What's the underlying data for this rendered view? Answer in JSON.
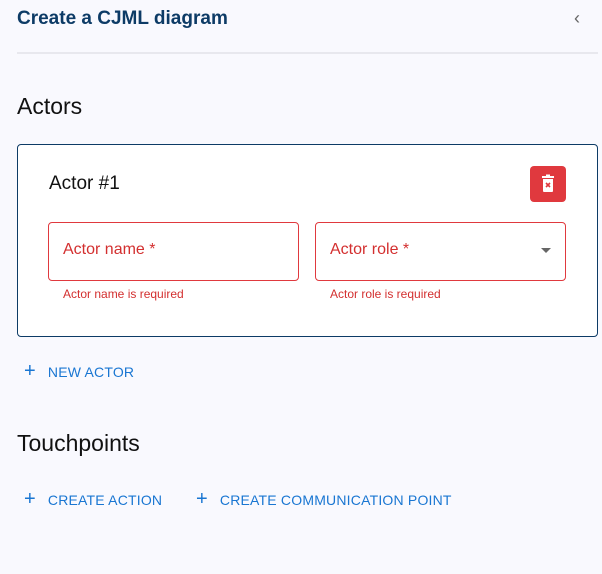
{
  "header": {
    "title": "Create a CJML diagram",
    "collapse_icon": "chevron-left-icon"
  },
  "actors": {
    "heading": "Actors",
    "items": [
      {
        "title": "Actor #1",
        "name_label": "Actor name *",
        "name_error": "Actor name is required",
        "role_label": "Actor role *",
        "role_error": "Actor role is required"
      }
    ],
    "new_actor_label": "NEW ACTOR"
  },
  "touchpoints": {
    "heading": "Touchpoints",
    "create_action_label": "CREATE ACTION",
    "create_communication_label": "CREATE COMMUNICATION POINT"
  },
  "colors": {
    "primary": "#0d3b66",
    "error": "#e0393e",
    "link": "#1976d2"
  }
}
